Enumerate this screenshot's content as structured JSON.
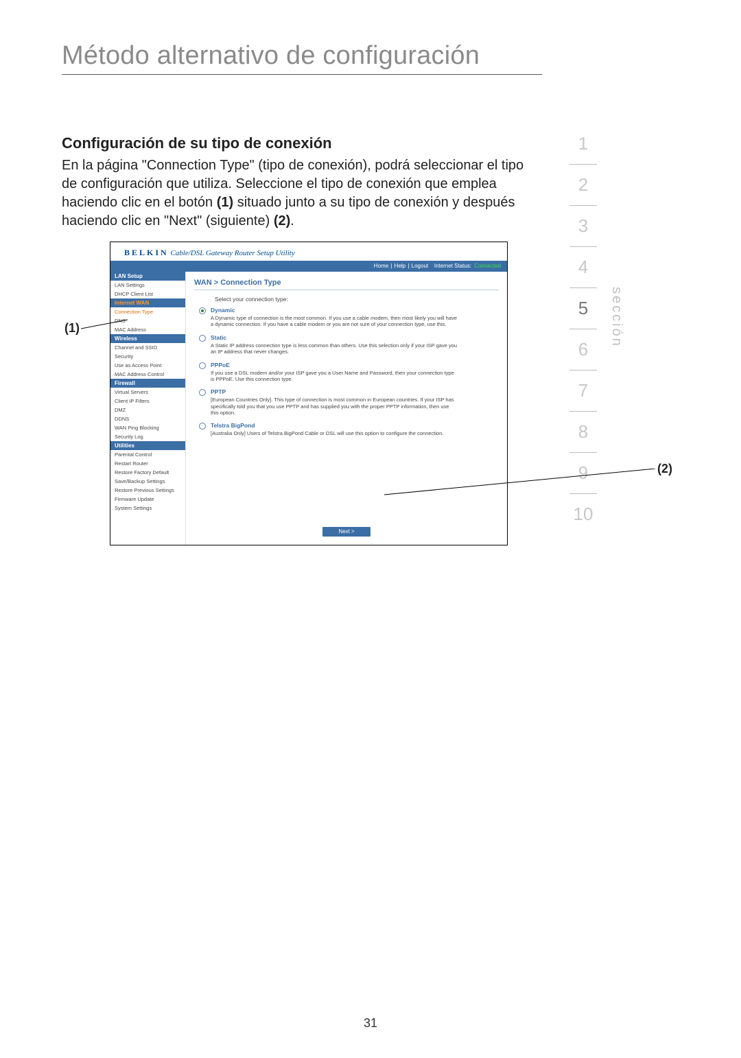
{
  "page": {
    "title": "Método alternativo de configuración",
    "section_heading": "Configuración de su tipo de conexión",
    "body_p1_a": "En la página \"Connection Type\" (tipo de conexión), podrá seleccionar el tipo de configuración que utiliza. Seleccione el tipo de conexión que emplea haciendo clic en el botón ",
    "body_bold1": "(1)",
    "body_p1_b": " situado junto a su tipo de conexión y después haciendo clic en \"Next\" (siguiente) ",
    "body_bold2": "(2)",
    "body_p1_c": ".",
    "page_number": "31",
    "callout_1": "(1)",
    "callout_2": "(2)"
  },
  "section_tabs": [
    "1",
    "2",
    "3",
    "4",
    "5",
    "6",
    "7",
    "8",
    "9",
    "10"
  ],
  "section_active_index": 4,
  "seccion_label": "sección",
  "router": {
    "brand": "BELKIN",
    "brand_sub": "Cable/DSL Gateway Router Setup Utility",
    "topbar": {
      "home": "Home",
      "help": "Help",
      "logout": "Logout",
      "status_label": "Internet Status:",
      "status_value": "Connected"
    },
    "sidebar": [
      {
        "type": "heading",
        "label": "LAN Setup"
      },
      {
        "type": "item",
        "label": "LAN Settings"
      },
      {
        "type": "item",
        "label": "DHCP Client List"
      },
      {
        "type": "heading",
        "label": "Internet WAN",
        "variant": "orange"
      },
      {
        "type": "item",
        "label": "Connection Type",
        "variant": "orange"
      },
      {
        "type": "item",
        "label": "DNS"
      },
      {
        "type": "item",
        "label": "MAC Address"
      },
      {
        "type": "heading",
        "label": "Wireless"
      },
      {
        "type": "item",
        "label": "Channel and SSID"
      },
      {
        "type": "item",
        "label": "Security"
      },
      {
        "type": "item",
        "label": "Use as Access Point"
      },
      {
        "type": "item",
        "label": "MAC Address Control"
      },
      {
        "type": "heading",
        "label": "Firewall"
      },
      {
        "type": "item",
        "label": "Virtual Servers"
      },
      {
        "type": "item",
        "label": "Client IP Filters"
      },
      {
        "type": "item",
        "label": "DMZ"
      },
      {
        "type": "item",
        "label": "DDNS"
      },
      {
        "type": "item",
        "label": "WAN Ping Blocking"
      },
      {
        "type": "item",
        "label": "Security Log"
      },
      {
        "type": "heading",
        "label": "Utilities"
      },
      {
        "type": "item",
        "label": "Parental Control"
      },
      {
        "type": "item",
        "label": "Restart Router"
      },
      {
        "type": "item",
        "label": "Restore Factory Default"
      },
      {
        "type": "item",
        "label": "Save/Backup Settings"
      },
      {
        "type": "item",
        "label": "Restore Previous Settings"
      },
      {
        "type": "item",
        "label": "Firmware Update"
      },
      {
        "type": "item",
        "label": "System Settings"
      }
    ],
    "main": {
      "breadcrumb": "WAN > Connection Type",
      "select_label": "Select your connection type:",
      "options": [
        {
          "title": "Dynamic",
          "desc": "A Dynamic type of connection is the most common. If you use a cable modem, then most likely you will have a dynamic connection. If you have a cable modem or you are not sure of your connection type, use this."
        },
        {
          "title": "Static",
          "desc": "A Static IP address connection type is less common than others. Use this selection only if your ISP gave you an IP address that never changes."
        },
        {
          "title": "PPPoE",
          "desc": "If you use a DSL modem and/or your ISP gave you a User Name and Password, then your connection type is PPPoE. Use this connection type."
        },
        {
          "title": "PPTP",
          "desc": "[European Countries Only]. This type of connection is most common in European countries. If your ISP has specifically told you that you use PPTP and has supplied you with the proper PPTP information, then use this option."
        },
        {
          "title": "Telstra BigPond",
          "desc": "[Australia Only] Users of Telstra BigPond Cable or DSL will use this option to configure the connection."
        }
      ],
      "selected_index": 0,
      "next_label": "Next >"
    }
  }
}
